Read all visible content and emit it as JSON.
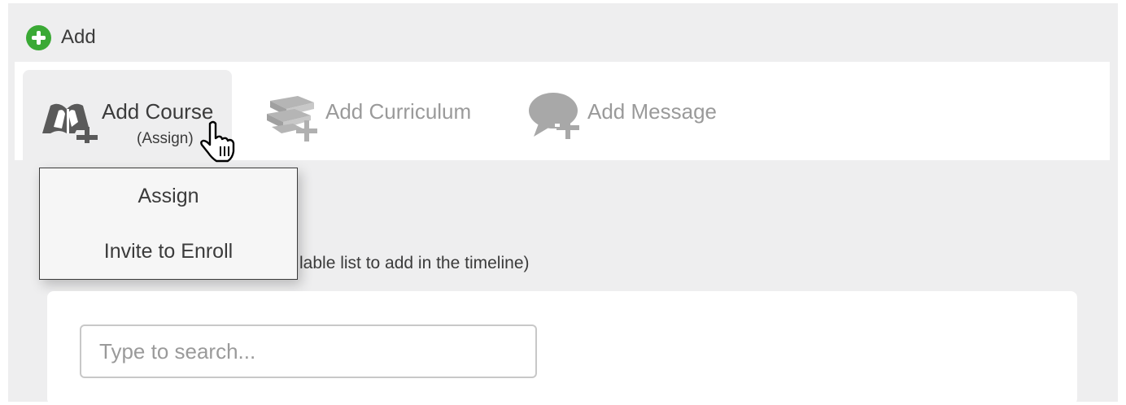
{
  "header": {
    "add_label": "Add"
  },
  "tabs": [
    {
      "label": "Add Course",
      "sublabel": "(Assign)",
      "icon": "book-plus-icon",
      "active": true
    },
    {
      "label": "Add Curriculum",
      "icon": "books-plus-icon",
      "active": false
    },
    {
      "label": "Add Message",
      "icon": "speech-bubble-plus-icon",
      "active": false
    }
  ],
  "dropdown": {
    "items": [
      "Assign",
      "Invite to Enroll"
    ]
  },
  "helper_text": "lable list to add in the timeline)",
  "search": {
    "placeholder": "Type to search..."
  },
  "colors": {
    "accent_green": "#3aa935",
    "text_dark": "#3b3b3b",
    "text_gray": "#9a9a9a",
    "panel_bg": "#eeeeef"
  }
}
